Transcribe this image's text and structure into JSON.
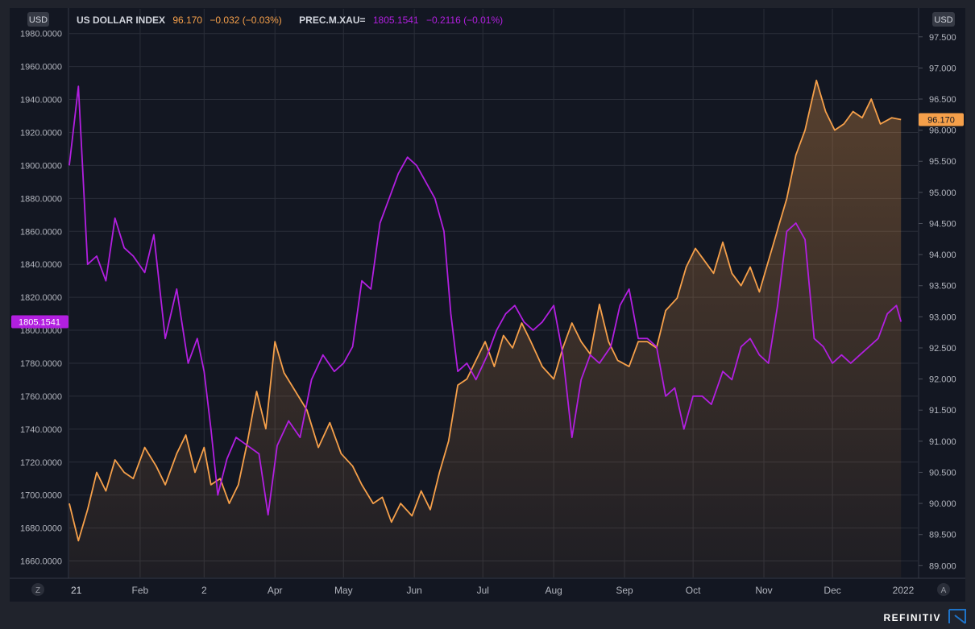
{
  "left_currency_badge": "USD",
  "right_currency_badge": "USD",
  "legend": {
    "series1_name": "US DOLLAR INDEX",
    "series1_value": "96.170",
    "series1_change": "−0.032 (−0.03%)",
    "series2_name": "PREC.M.XAU=",
    "series2_value": "1805.1541",
    "series2_change": "−0.2116 (−0.01%)"
  },
  "current_value_tags": {
    "right": "96.170",
    "left": "1805.1541"
  },
  "corner_buttons": {
    "left": "Z",
    "right": "A"
  },
  "brand": "REFINITIV",
  "colors": {
    "background": "#131722",
    "outer": "#20232c",
    "grid": "#2a2e39",
    "text": "#b2b5be",
    "dxy": "#f6a04a",
    "gold": "#b21fe0",
    "badge": "#363a45"
  },
  "chart_data": {
    "type": "line",
    "x_ticks": [
      "21",
      "Feb",
      "2",
      "Apr",
      "May",
      "Jun",
      "Jul",
      "Aug",
      "Sep",
      "Oct",
      "Nov",
      "Dec",
      "2022"
    ],
    "x_tick_dates": [
      "2021-01-01",
      "2021-02-01",
      "2021-03-01",
      "2021-04-01",
      "2021-05-01",
      "2021-06-01",
      "2021-07-01",
      "2021-08-01",
      "2021-09-01",
      "2021-10-01",
      "2021-11-01",
      "2021-12-01",
      "2022-01-01"
    ],
    "left_axis": {
      "ylim": [
        1650,
        1995
      ],
      "ticks": [
        "1980.0000",
        "1960.0000",
        "1940.0000",
        "1920.0000",
        "1900.0000",
        "1880.0000",
        "1860.0000",
        "1840.0000",
        "1820.0000",
        "1800.0000",
        "1780.0000",
        "1760.0000",
        "1740.0000",
        "1720.0000",
        "1700.0000",
        "1680.0000",
        "1660.0000"
      ]
    },
    "right_axis": {
      "ylim": [
        88.81,
        97.95
      ],
      "ticks": [
        "97.500",
        "97.000",
        "96.500",
        "96.000",
        "95.500",
        "95.000",
        "94.500",
        "94.000",
        "93.500",
        "93.000",
        "92.500",
        "92.000",
        "91.500",
        "91.000",
        "90.500",
        "90.000",
        "89.500",
        "89.000"
      ]
    },
    "grid": true,
    "series": [
      {
        "name": "US DOLLAR INDEX",
        "axis": "right",
        "style": "area",
        "color": "#f6a04a",
        "points": [
          [
            "2021-01-01",
            90.0
          ],
          [
            "2021-01-05",
            89.4
          ],
          [
            "2021-01-09",
            89.9
          ],
          [
            "2021-01-13",
            90.5
          ],
          [
            "2021-01-17",
            90.2
          ],
          [
            "2021-01-21",
            90.7
          ],
          [
            "2021-01-25",
            90.5
          ],
          [
            "2021-01-29",
            90.4
          ],
          [
            "2021-02-03",
            90.9
          ],
          [
            "2021-02-08",
            90.6
          ],
          [
            "2021-02-12",
            90.3
          ],
          [
            "2021-02-17",
            90.8
          ],
          [
            "2021-02-21",
            91.1
          ],
          [
            "2021-02-25",
            90.5
          ],
          [
            "2021-03-01",
            90.9
          ],
          [
            "2021-03-04",
            90.3
          ],
          [
            "2021-03-08",
            90.4
          ],
          [
            "2021-03-12",
            90.0
          ],
          [
            "2021-03-16",
            90.3
          ],
          [
            "2021-03-20",
            91.0
          ],
          [
            "2021-03-24",
            91.8
          ],
          [
            "2021-03-28",
            91.2
          ],
          [
            "2021-04-01",
            92.6
          ],
          [
            "2021-04-05",
            92.1
          ],
          [
            "2021-04-10",
            91.8
          ],
          [
            "2021-04-15",
            91.5
          ],
          [
            "2021-04-20",
            90.9
          ],
          [
            "2021-04-25",
            91.3
          ],
          [
            "2021-04-30",
            90.8
          ],
          [
            "2021-05-05",
            90.6
          ],
          [
            "2021-05-09",
            90.3
          ],
          [
            "2021-05-14",
            90.0
          ],
          [
            "2021-05-18",
            90.1
          ],
          [
            "2021-05-22",
            89.7
          ],
          [
            "2021-05-26",
            90.0
          ],
          [
            "2021-05-31",
            89.8
          ],
          [
            "2021-06-04",
            90.2
          ],
          [
            "2021-06-08",
            89.9
          ],
          [
            "2021-06-12",
            90.5
          ],
          [
            "2021-06-16",
            91.0
          ],
          [
            "2021-06-20",
            91.9
          ],
          [
            "2021-06-24",
            92.0
          ],
          [
            "2021-06-28",
            92.3
          ],
          [
            "2021-07-02",
            92.6
          ],
          [
            "2021-07-06",
            92.2
          ],
          [
            "2021-07-10",
            92.7
          ],
          [
            "2021-07-14",
            92.5
          ],
          [
            "2021-07-18",
            92.9
          ],
          [
            "2021-07-22",
            92.6
          ],
          [
            "2021-07-27",
            92.2
          ],
          [
            "2021-08-01",
            92.0
          ],
          [
            "2021-08-05",
            92.5
          ],
          [
            "2021-08-09",
            92.9
          ],
          [
            "2021-08-13",
            92.6
          ],
          [
            "2021-08-17",
            92.4
          ],
          [
            "2021-08-21",
            93.2
          ],
          [
            "2021-08-25",
            92.6
          ],
          [
            "2021-08-29",
            92.3
          ],
          [
            "2021-09-03",
            92.2
          ],
          [
            "2021-09-07",
            92.6
          ],
          [
            "2021-09-11",
            92.6
          ],
          [
            "2021-09-15",
            92.5
          ],
          [
            "2021-09-19",
            93.1
          ],
          [
            "2021-09-24",
            93.3
          ],
          [
            "2021-09-28",
            93.8
          ],
          [
            "2021-10-02",
            94.1
          ],
          [
            "2021-10-06",
            93.9
          ],
          [
            "2021-10-10",
            93.7
          ],
          [
            "2021-10-14",
            94.2
          ],
          [
            "2021-10-18",
            93.7
          ],
          [
            "2021-10-22",
            93.5
          ],
          [
            "2021-10-26",
            93.8
          ],
          [
            "2021-10-30",
            93.4
          ],
          [
            "2021-11-03",
            93.9
          ],
          [
            "2021-11-07",
            94.4
          ],
          [
            "2021-11-11",
            94.9
          ],
          [
            "2021-11-15",
            95.6
          ],
          [
            "2021-11-19",
            96.0
          ],
          [
            "2021-11-24",
            96.8
          ],
          [
            "2021-11-28",
            96.3
          ],
          [
            "2021-12-02",
            96.0
          ],
          [
            "2021-12-06",
            96.1
          ],
          [
            "2021-12-10",
            96.3
          ],
          [
            "2021-12-14",
            96.2
          ],
          [
            "2021-12-18",
            96.5
          ],
          [
            "2021-12-22",
            96.1
          ],
          [
            "2021-12-27",
            96.2
          ],
          [
            "2021-12-31",
            96.17
          ]
        ]
      },
      {
        "name": "PREC.M.XAU=",
        "axis": "left",
        "style": "line",
        "color": "#b21fe0",
        "points": [
          [
            "2021-01-01",
            1900
          ],
          [
            "2021-01-05",
            1948
          ],
          [
            "2021-01-09",
            1840
          ],
          [
            "2021-01-13",
            1845
          ],
          [
            "2021-01-17",
            1830
          ],
          [
            "2021-01-21",
            1868
          ],
          [
            "2021-01-25",
            1850
          ],
          [
            "2021-01-29",
            1845
          ],
          [
            "2021-02-03",
            1835
          ],
          [
            "2021-02-07",
            1858
          ],
          [
            "2021-02-12",
            1795
          ],
          [
            "2021-02-17",
            1825
          ],
          [
            "2021-02-22",
            1780
          ],
          [
            "2021-02-26",
            1795
          ],
          [
            "2021-03-01",
            1775
          ],
          [
            "2021-03-04",
            1740
          ],
          [
            "2021-03-07",
            1700
          ],
          [
            "2021-03-11",
            1722
          ],
          [
            "2021-03-15",
            1735
          ],
          [
            "2021-03-20",
            1730
          ],
          [
            "2021-03-25",
            1725
          ],
          [
            "2021-03-29",
            1688
          ],
          [
            "2021-04-02",
            1730
          ],
          [
            "2021-04-07",
            1745
          ],
          [
            "2021-04-12",
            1735
          ],
          [
            "2021-04-17",
            1770
          ],
          [
            "2021-04-22",
            1785
          ],
          [
            "2021-04-27",
            1775
          ],
          [
            "2021-05-01",
            1780
          ],
          [
            "2021-05-05",
            1790
          ],
          [
            "2021-05-09",
            1830
          ],
          [
            "2021-05-13",
            1825
          ],
          [
            "2021-05-17",
            1865
          ],
          [
            "2021-05-21",
            1880
          ],
          [
            "2021-05-25",
            1895
          ],
          [
            "2021-05-29",
            1905
          ],
          [
            "2021-06-02",
            1900
          ],
          [
            "2021-06-06",
            1890
          ],
          [
            "2021-06-10",
            1880
          ],
          [
            "2021-06-14",
            1860
          ],
          [
            "2021-06-17",
            1810
          ],
          [
            "2021-06-20",
            1775
          ],
          [
            "2021-06-24",
            1780
          ],
          [
            "2021-06-28",
            1770
          ],
          [
            "2021-07-03",
            1785
          ],
          [
            "2021-07-07",
            1800
          ],
          [
            "2021-07-11",
            1810
          ],
          [
            "2021-07-15",
            1815
          ],
          [
            "2021-07-19",
            1805
          ],
          [
            "2021-07-23",
            1800
          ],
          [
            "2021-07-27",
            1805
          ],
          [
            "2021-08-01",
            1815
          ],
          [
            "2021-08-05",
            1785
          ],
          [
            "2021-08-09",
            1735
          ],
          [
            "2021-08-13",
            1770
          ],
          [
            "2021-08-17",
            1785
          ],
          [
            "2021-08-21",
            1780
          ],
          [
            "2021-08-26",
            1790
          ],
          [
            "2021-08-30",
            1815
          ],
          [
            "2021-09-03",
            1825
          ],
          [
            "2021-09-07",
            1795
          ],
          [
            "2021-09-11",
            1795
          ],
          [
            "2021-09-15",
            1790
          ],
          [
            "2021-09-19",
            1760
          ],
          [
            "2021-09-23",
            1765
          ],
          [
            "2021-09-27",
            1740
          ],
          [
            "2021-10-01",
            1760
          ],
          [
            "2021-10-05",
            1760
          ],
          [
            "2021-10-09",
            1755
          ],
          [
            "2021-10-14",
            1775
          ],
          [
            "2021-10-18",
            1770
          ],
          [
            "2021-10-22",
            1790
          ],
          [
            "2021-10-26",
            1795
          ],
          [
            "2021-10-30",
            1785
          ],
          [
            "2021-11-03",
            1780
          ],
          [
            "2021-11-07",
            1815
          ],
          [
            "2021-11-11",
            1860
          ],
          [
            "2021-11-15",
            1865
          ],
          [
            "2021-11-19",
            1855
          ],
          [
            "2021-11-23",
            1795
          ],
          [
            "2021-11-27",
            1790
          ],
          [
            "2021-12-01",
            1780
          ],
          [
            "2021-12-05",
            1785
          ],
          [
            "2021-12-09",
            1780
          ],
          [
            "2021-12-13",
            1785
          ],
          [
            "2021-12-17",
            1790
          ],
          [
            "2021-12-21",
            1795
          ],
          [
            "2021-12-25",
            1810
          ],
          [
            "2021-12-29",
            1815
          ],
          [
            "2021-12-31",
            1805.15
          ]
        ]
      }
    ]
  }
}
